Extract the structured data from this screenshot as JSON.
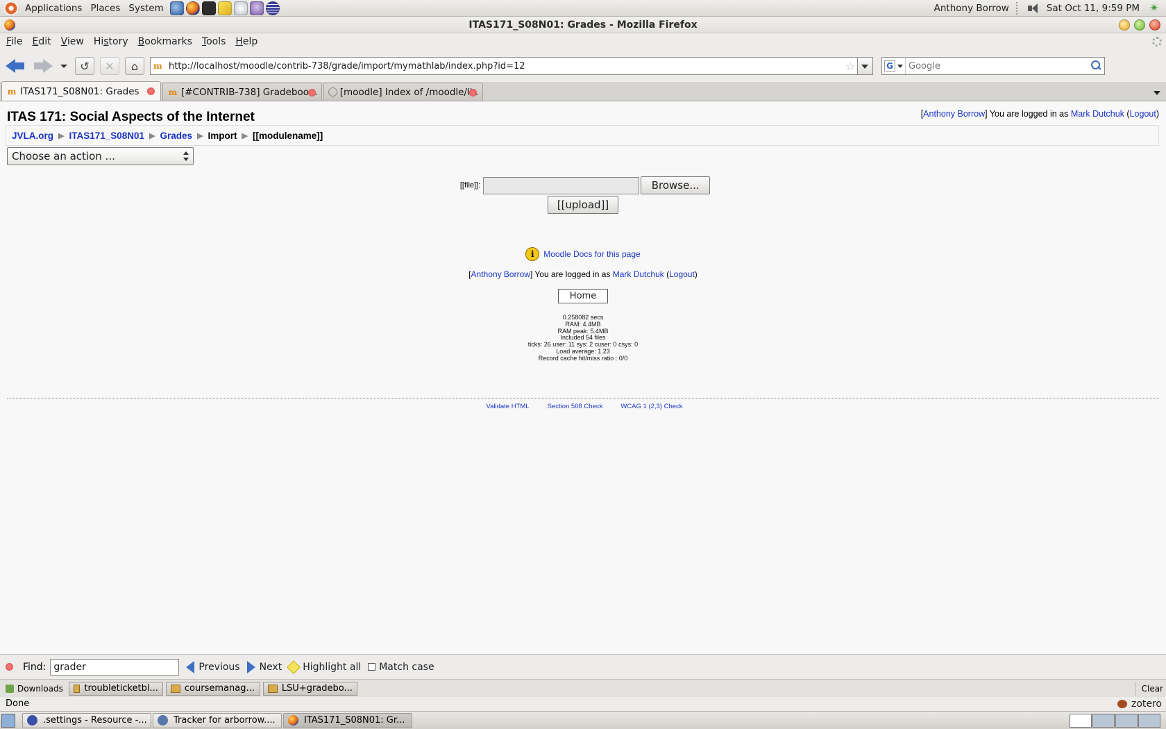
{
  "top_panel": {
    "menus": [
      "Applications",
      "Places",
      "System"
    ],
    "user": "Anthony Borrow",
    "clock": "Sat Oct 11,  9:59 PM"
  },
  "window": {
    "title": "ITAS171_S08N01: Grades - Mozilla Firefox"
  },
  "menu_bar": [
    {
      "u": "F",
      "rest": "ile"
    },
    {
      "u": "E",
      "rest": "dit"
    },
    {
      "u": "V",
      "rest": "iew"
    },
    {
      "u": "",
      "rest": "History",
      "pre": "Hi",
      "uu": "s",
      "post": "tory"
    },
    {
      "u": "B",
      "rest": "ookmarks"
    },
    {
      "u": "T",
      "rest": "ools"
    },
    {
      "u": "H",
      "rest": "elp"
    }
  ],
  "nav": {
    "url": "http://localhost/moodle/contrib-738/grade/import/mymathlab/index.php?id=12",
    "search_placeholder": "Google"
  },
  "tabs": [
    {
      "label": "ITAS171_S08N01: Grades",
      "favicon": "moodle-icon",
      "active": true
    },
    {
      "label": "[#CONTRIB-738] Gradeboo...",
      "favicon": "moodle-icon",
      "active": false
    },
    {
      "label": "[moodle] Index of /moodle/li...",
      "favicon": "page-icon",
      "active": false
    }
  ],
  "page": {
    "title": "ITAS 171: Social Aspects of the Internet",
    "login": {
      "real_user": "Anthony Borrow",
      "text": " You are logged in as ",
      "user": "Mark Dutchuk",
      "logout": "Logout"
    },
    "breadcrumb": [
      "JVLA.org",
      "ITAS171_S08N01",
      "Grades",
      "Import",
      "[[modulename]]"
    ],
    "action_select": "Choose an action ...",
    "file_label": "[[file]]:",
    "browse_label": "Browse...",
    "upload_label": "[[upload]]",
    "docs_link": "Moodle Docs for this page",
    "home_label": "Home",
    "perf": [
      "0.258082 secs",
      "RAM: 4.4MB",
      "RAM peak: 5.4MB",
      "Included 54 files",
      "ticks: 26 user: 11 sys: 2 cuser: 0 csys: 0",
      "Load average: 1.23",
      "Record cache hit/miss ratio : 0/0"
    ],
    "validators": [
      "Validate HTML",
      "Section 508 Check",
      "WCAG 1 (2,3) Check"
    ]
  },
  "find_bar": {
    "label": "Find:",
    "value": "grader",
    "previous": "Previous",
    "next": "Next",
    "highlight": "Highlight all",
    "match_case": "Match case"
  },
  "downloads": {
    "label": "Downloads",
    "items": [
      "troubleticketbl...",
      "coursemanag...",
      "LSU+gradebo..."
    ],
    "clear": "Clear"
  },
  "status": {
    "text": "Done",
    "zotero": "zotero"
  },
  "taskbar": [
    {
      "label": ".settings - Resource -...",
      "icon_color": "#3b4fa8"
    },
    {
      "label": "Tracker for arborrow....",
      "icon_color": "#5577aa"
    },
    {
      "label": "ITAS171_S08N01: Gr...",
      "icon_color": "#e46a12"
    }
  ]
}
